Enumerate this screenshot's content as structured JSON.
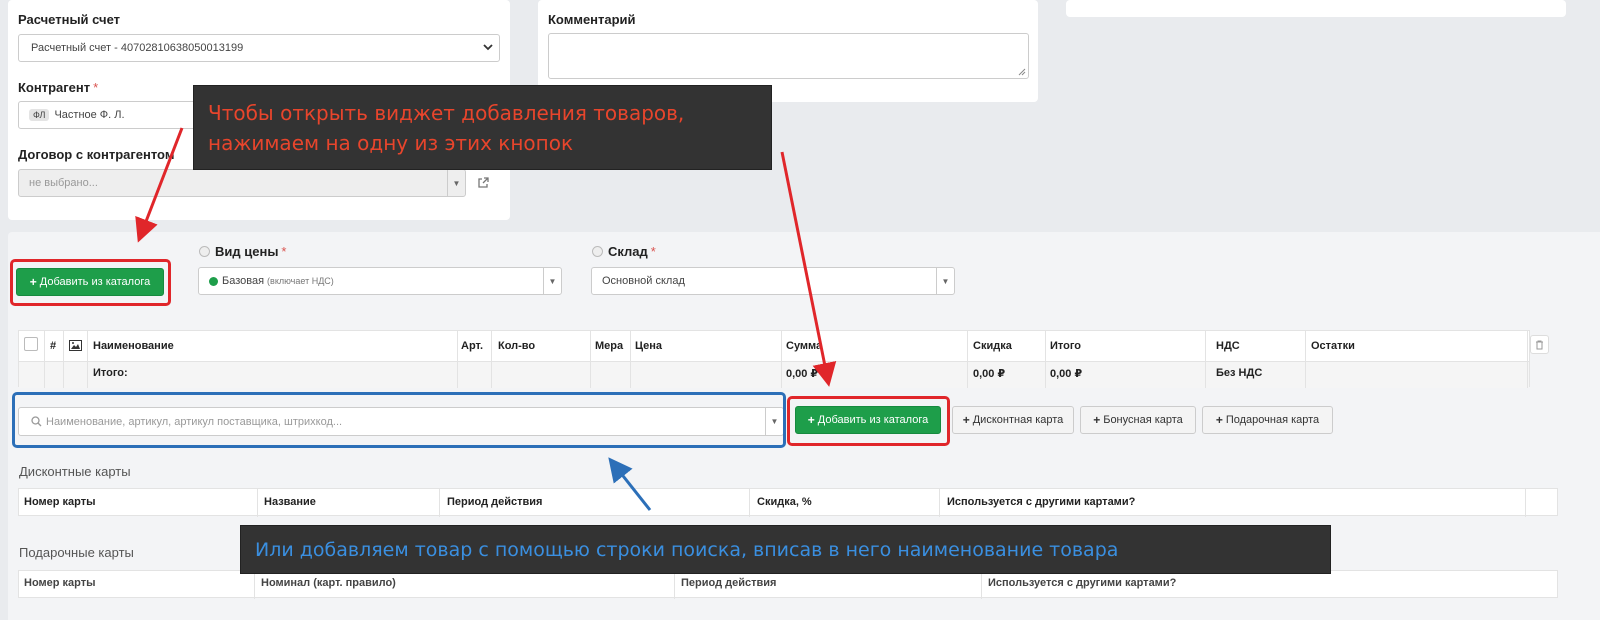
{
  "form": {
    "account_label": "Расчетный счет",
    "account_value": "Расчетный счет - 40702810638050013199",
    "contractor_label": "Контрагент",
    "required_mark": "*",
    "contractor_tag": "ФЛ",
    "contractor_value": "Частное Ф. Л.",
    "contract_label": "Договор с контрагентом",
    "contract_placeholder": "не выбрано...",
    "comment_label": "Комментарий",
    "comment_value": ""
  },
  "goods": {
    "add_catalog_label": "Добавить из каталога",
    "price_type_label": "Вид цены",
    "price_type_value": "Базовая",
    "price_type_note": "(включает НДС)",
    "price_type_dot_color": "#1e9e4a",
    "warehouse_label": "Склад",
    "warehouse_value": "Основной склад"
  },
  "table": {
    "headers": {
      "num": "#",
      "name": "Наименование",
      "art": "Арт.",
      "qty": "Кол-во",
      "unit": "Мера",
      "price": "Цена",
      "sum": "Сумма",
      "discount": "Скидка",
      "total": "Итого",
      "vat": "НДС",
      "stock": "Остатки"
    },
    "totals": {
      "label": "Итого:",
      "sum": "0,00 ₽",
      "discount": "0,00 ₽",
      "total": "0,00 ₽",
      "vat": "Без НДС"
    }
  },
  "search": {
    "placeholder": "Наименование, артикул, артикул поставщика, штрихкод...",
    "add_catalog_label": "Добавить из каталога",
    "discount_card_label": "Дисконтная карта",
    "bonus_card_label": "Бонусная карта",
    "gift_card_label": "Подарочная карта"
  },
  "discount_cards": {
    "title": "Дисконтные карты",
    "col_number": "Номер карты",
    "col_name": "Название",
    "col_period": "Период действия",
    "col_discount": "Скидка, %",
    "col_combined": "Используется с другими картами?"
  },
  "gift_cards": {
    "title": "Подарочные карты",
    "col_number": "Номер карты",
    "col_nominal": "Номинал (карт. правило)",
    "col_period": "Период действия",
    "col_combined": "Используется с другими картами?"
  },
  "annotations": {
    "callout_top_line1": "Чтобы открыть виджет добавления товаров,",
    "callout_top_line2": "нажимаем на одну из этих кнопок",
    "callout_top_color": "#e8452c",
    "callout_bottom": "Или добавляем товар с помощью строки поиска, вписав в него наименование товара",
    "callout_bottom_color": "#3a8fe0",
    "highlight_red": "#e0262a",
    "highlight_blue": "#2c6fb8"
  }
}
